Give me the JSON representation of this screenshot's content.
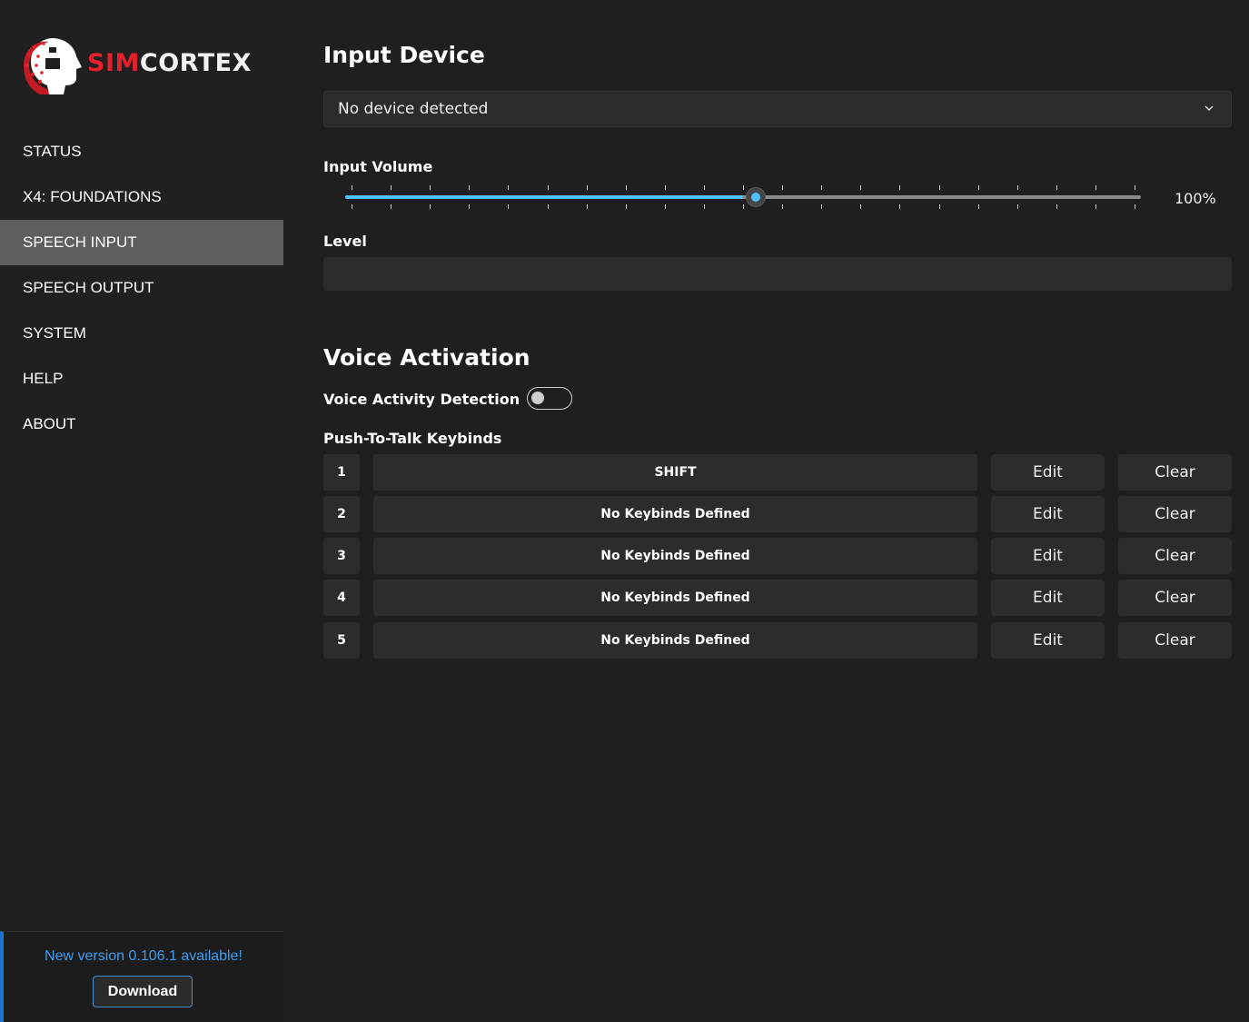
{
  "app": {
    "logo_text_red": "SIM",
    "logo_text_white": "CORTEX",
    "brand_red": "#e5202a",
    "accent": "#4cc2ff"
  },
  "sidebar": {
    "items": [
      {
        "label": "STATUS",
        "active": false
      },
      {
        "label": "X4: FOUNDATIONS",
        "active": false
      },
      {
        "label": "SPEECH INPUT",
        "active": true
      },
      {
        "label": "SPEECH OUTPUT",
        "active": false
      },
      {
        "label": "SYSTEM",
        "active": false
      },
      {
        "label": "HELP",
        "active": false
      },
      {
        "label": "ABOUT",
        "active": false
      }
    ],
    "update": {
      "message": "New version 0.106.1 available!",
      "download_label": "Download"
    }
  },
  "input_device": {
    "title": "Input Device",
    "selected": "No device detected"
  },
  "input_volume": {
    "label": "Input Volume",
    "value_text": "100%",
    "fill_fraction": 0.5
  },
  "level": {
    "label": "Level"
  },
  "voice_activation": {
    "title": "Voice Activation",
    "vad_label": "Voice Activity Detection",
    "vad_enabled": false,
    "ptt_label": "Push-To-Talk Keybinds",
    "keybinds": [
      {
        "num": "1",
        "binding": "SHIFT"
      },
      {
        "num": "2",
        "binding": "No Keybinds Defined"
      },
      {
        "num": "3",
        "binding": "No Keybinds Defined"
      },
      {
        "num": "4",
        "binding": "No Keybinds Defined"
      },
      {
        "num": "5",
        "binding": "No Keybinds Defined"
      }
    ],
    "edit_label": "Edit",
    "clear_label": "Clear"
  }
}
